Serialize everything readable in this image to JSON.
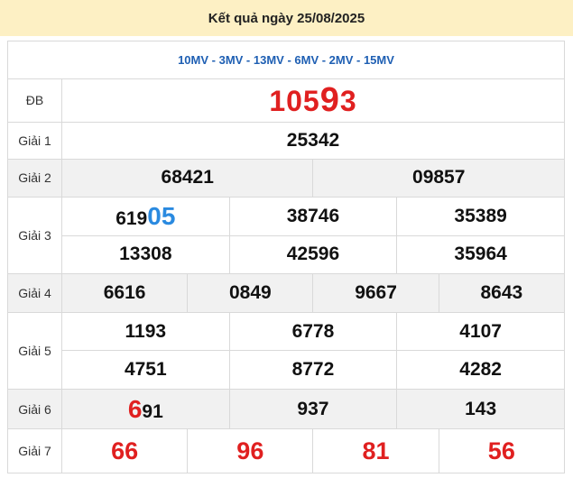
{
  "title": "Kết quả ngày 25/08/2025",
  "station_codes": "10MV - 3MV - 13MV - 6MV - 2MV - 15MV",
  "rows": {
    "db": {
      "label": "ĐB",
      "prefix": "105",
      "highlight": "9",
      "suffix": "3"
    },
    "g1": {
      "label": "Giải 1",
      "values": [
        "25342"
      ]
    },
    "g2": {
      "label": "Giải 2",
      "values": [
        "68421",
        "09857"
      ]
    },
    "g3": {
      "label": "Giải 3",
      "first_prefix": "619",
      "first_highlight": "05",
      "values": [
        "38746",
        "35389",
        "13308",
        "42596",
        "35964"
      ]
    },
    "g4": {
      "label": "Giải 4",
      "values": [
        "6616",
        "0849",
        "9667",
        "8643"
      ]
    },
    "g5": {
      "label": "Giải 5",
      "values": [
        "1193",
        "6778",
        "4107",
        "4751",
        "8772",
        "4282"
      ]
    },
    "g6": {
      "label": "Giải 6",
      "first_highlight": "6",
      "first_suffix": "91",
      "values": [
        "937",
        "143"
      ]
    },
    "g7": {
      "label": "Giải 7",
      "values": [
        "66",
        "96",
        "81",
        "56"
      ]
    }
  },
  "colors": {
    "header_bg": "#fdf0c4",
    "code_text": "#1e5fb3",
    "red": "#e02020",
    "blue": "#2a8ae0",
    "shade": "#f1f1f1"
  }
}
